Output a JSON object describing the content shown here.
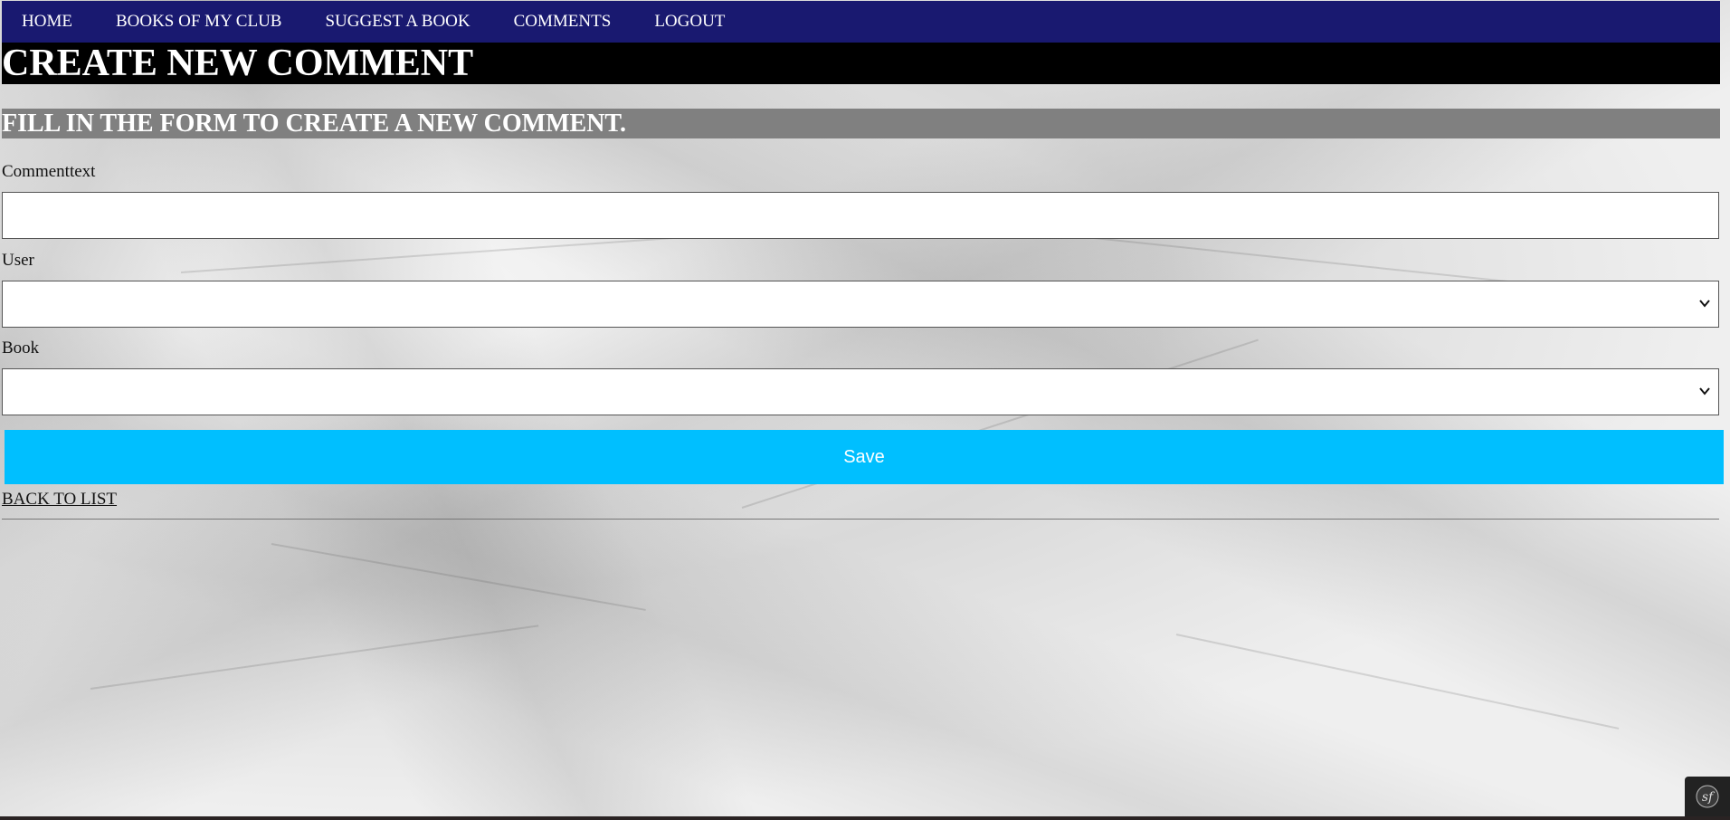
{
  "nav": {
    "items": [
      {
        "label": "HOME"
      },
      {
        "label": "BOOKS OF MY CLUB"
      },
      {
        "label": "SUGGEST A BOOK"
      },
      {
        "label": "COMMENTS"
      },
      {
        "label": "LOGOUT"
      }
    ]
  },
  "page": {
    "title": "CREATE NEW COMMENT",
    "subtitle": "FILL IN THE FORM TO CREATE A NEW COMMENT."
  },
  "form": {
    "commenttext": {
      "label": "Commenttext",
      "value": ""
    },
    "user": {
      "label": "User",
      "selected": ""
    },
    "book": {
      "label": "Book",
      "selected": ""
    },
    "save_label": "Save"
  },
  "links": {
    "back_to_list": "BACK TO LIST"
  },
  "colors": {
    "nav_bg": "#191970",
    "title_bg": "#000000",
    "subtitle_bg": "#808080",
    "save_bg": "#00bfff"
  },
  "icons": {
    "select_arrow": "chevron-down-icon",
    "toolbar": "symfony-icon"
  }
}
